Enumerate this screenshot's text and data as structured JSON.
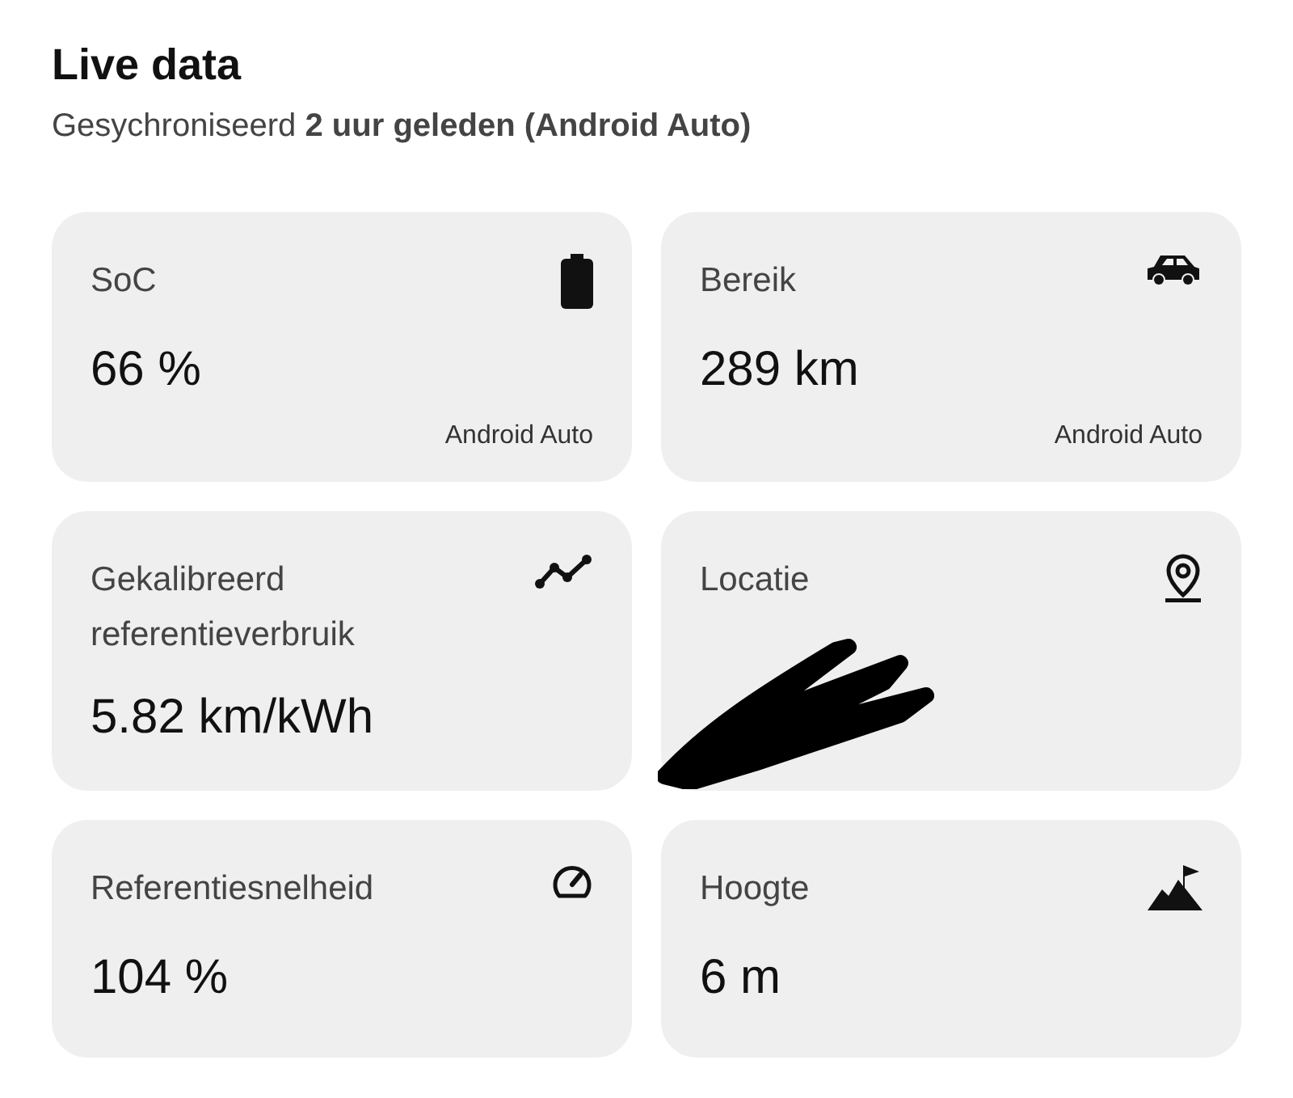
{
  "header": {
    "title": "Live data",
    "subtitle": "Gesychroniseerd **2 uur geleden (Android Auto)**"
  },
  "cards": [
    {
      "label": "SoC",
      "value": "66 %",
      "source": "Android Auto"
    },
    {
      "label": "Bereik",
      "value": "289 km",
      "source": "Android Auto"
    },
    {
      "label": "Gekalibreerd referentieverbruik",
      "value": "5.82 km/kWh"
    },
    {
      "label": "Locatie",
      "redacted": true
    },
    {
      "label": "Referentiesnelheid",
      "value": "104 %"
    },
    {
      "label": "Hoogte",
      "value": "6 m"
    }
  ]
}
